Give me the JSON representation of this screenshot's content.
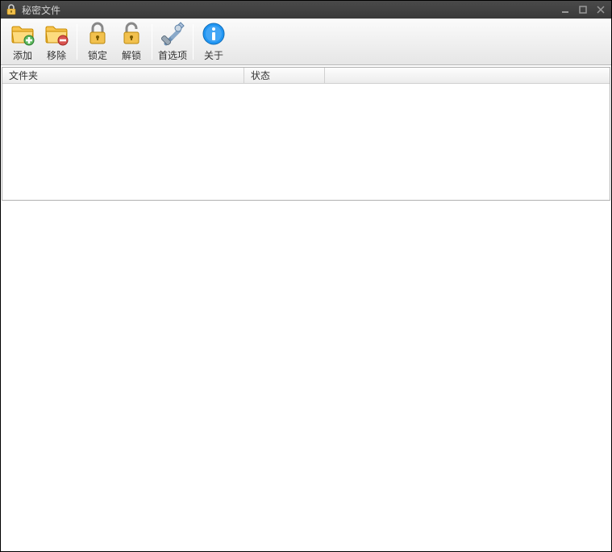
{
  "window": {
    "title": "秘密文件"
  },
  "toolbar": {
    "add": "添加",
    "remove": "移除",
    "lock": "锁定",
    "unlock": "解锁",
    "preferences": "首选项",
    "about": "关于"
  },
  "columns": {
    "folder": "文件夹",
    "status": "状态"
  }
}
